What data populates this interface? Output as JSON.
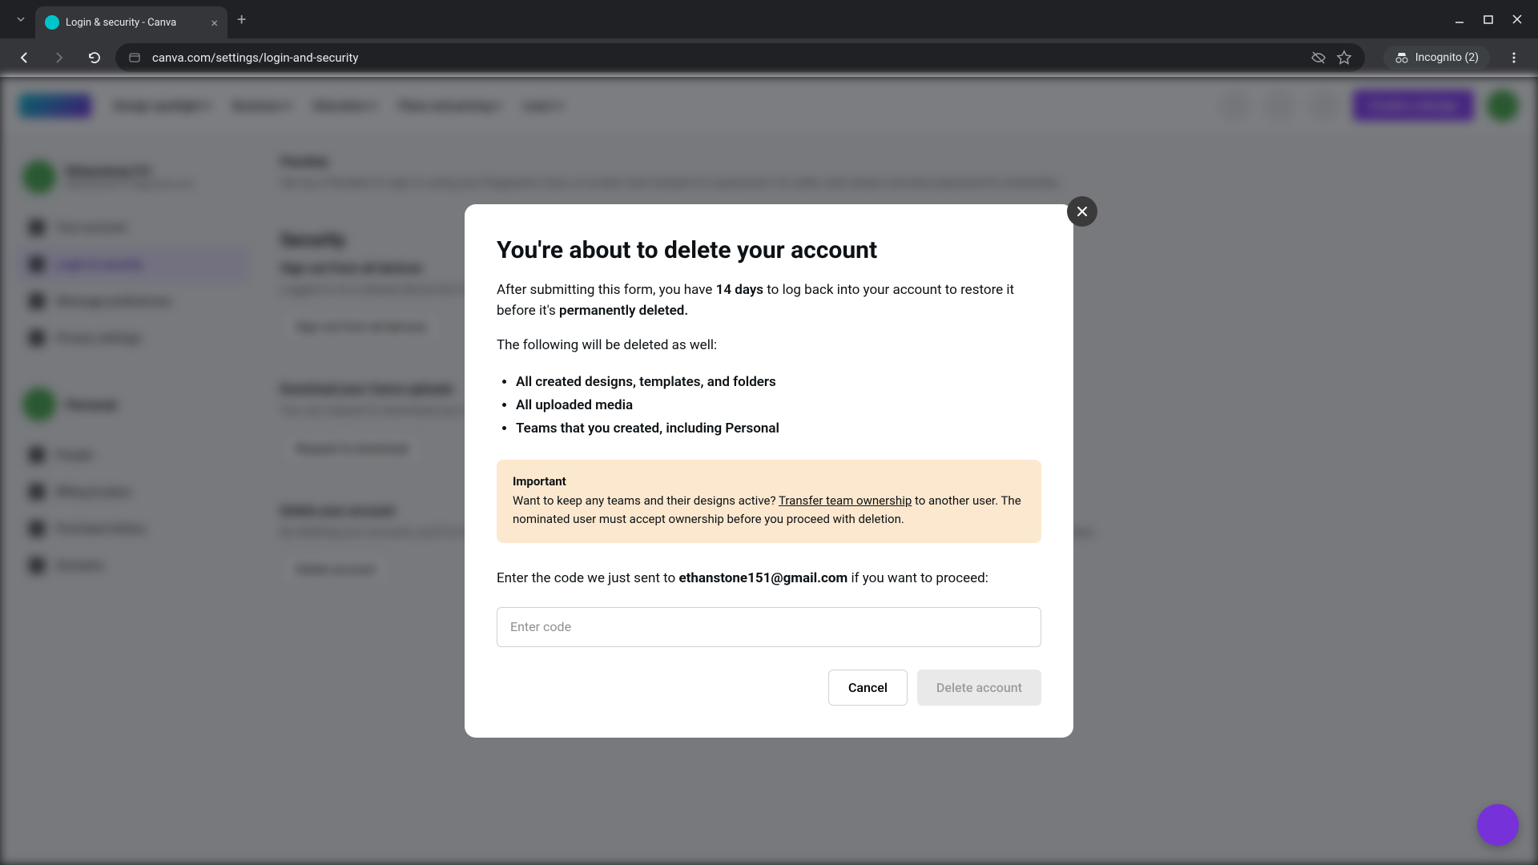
{
  "browser": {
    "tab_title": "Login & security - Canva",
    "url": "canva.com/settings/login-and-security",
    "incognito": "Incognito (2)"
  },
  "header": {
    "nav": [
      "Design spotlight",
      "Business",
      "Education",
      "Plans and pricing",
      "Learn"
    ],
    "create": "Create a design"
  },
  "sidebar": {
    "user_name": "Ethanstone151",
    "user_email": "ethanstone151@gmail.com",
    "items": [
      "Your account",
      "Login & security",
      "Message preferences",
      "Privacy settings"
    ],
    "team_label": "Personal",
    "team_items": [
      "People",
      "Billing & plans",
      "Purchase history",
      "Domains"
    ]
  },
  "page": {
    "passkey_title": "Passkey",
    "security_title": "Security",
    "signout_title": "Sign out from all devices",
    "signout_btn": "Sign out from all devices",
    "download_title": "Download your Canva uploads",
    "download_btn": "Request to download",
    "delete_title": "Delete your account",
    "delete_btn": "Delete account"
  },
  "modal": {
    "title": "You're about to delete your account",
    "intro_1": "After submitting this form, you have ",
    "intro_days": "14 days",
    "intro_2": " to log back into your account to restore it before it's ",
    "intro_perm": "permanently deleted.",
    "following": "The following will be deleted as well:",
    "list": [
      "All created designs, templates, and folders",
      "All uploaded media",
      "Teams that you created, including Personal"
    ],
    "important_title": "Important",
    "important_1": "Want to keep any teams and their designs active? ",
    "important_link": "Transfer team ownership",
    "important_2": " to another user. The nominated user must accept ownership before you proceed with deletion.",
    "code_1": "Enter the code we just sent to ",
    "code_email": "ethanstone151@gmail.com",
    "code_2": " if you want to proceed:",
    "code_placeholder": "Enter code",
    "cancel": "Cancel",
    "delete": "Delete account"
  }
}
